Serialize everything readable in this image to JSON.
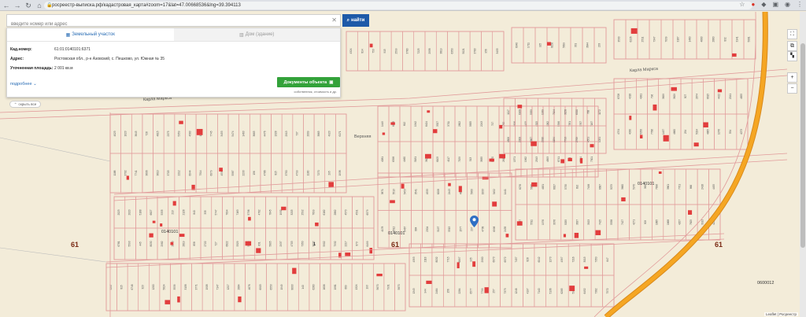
{
  "browser": {
    "url": "росреестр-выписка.рф/кадастровая_карта#zoom=17&lat=47.00668536&lng=39.394113",
    "back_icon": "arrow-left-icon",
    "forward_icon": "arrow-right-icon",
    "reload_icon": "reload-icon"
  },
  "search": {
    "placeholder": "введите номер или адрес",
    "clear": "✕",
    "button": "найти"
  },
  "panel": {
    "tabs": [
      {
        "label": "Земельный участок",
        "active": true
      },
      {
        "label": "Дом (здание)",
        "active": false
      }
    ],
    "fields": [
      {
        "key": "Кад.номер:",
        "value": "61:01:0140101:6371"
      },
      {
        "key": "Адрес:",
        "value": "Ростовская обл., р-н Азовский, с. Пешково, ул. Южная № 35"
      },
      {
        "key": "Уточненная площадь:",
        "value": "2 001 кв.м"
      }
    ],
    "more": "подробнее",
    "docs_button": "Документы объекта",
    "docs_note": "собственник, стоимость и др."
  },
  "map": {
    "hide_all": "скрыть все",
    "streets": [
      "Карла Маркса",
      "Карла Маркса"
    ],
    "street_small": "Верхняя",
    "quarters": [
      "0140101",
      "0140101",
      "0140101",
      "0140101"
    ],
    "region_labels": [
      "61",
      "61",
      "61"
    ],
    "extra_label": "0600012",
    "small_label": "1",
    "marker_icon": "location-pin-icon",
    "colors": {
      "background": "#f3ecd9",
      "parcel_line": "#e19a9a",
      "building": "#e23d3d",
      "road": "#f5a623",
      "accent": "#1e5aa8",
      "docs_button": "#33a23a"
    }
  },
  "controls": {
    "fullscreen": "⛶",
    "layers": "⧉",
    "zoom_in": "+",
    "zoom_out": "−"
  },
  "attribution": "Leaflet | Росреестр"
}
